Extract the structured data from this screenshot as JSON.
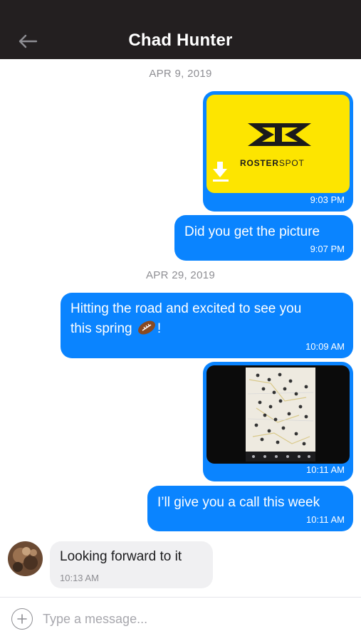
{
  "header": {
    "title": "Chad Hunter",
    "back_icon": "arrow-left-icon",
    "background": "#231f20"
  },
  "colors": {
    "outgoing_bubble": "#0a84ff",
    "incoming_bubble": "#f0f0f2",
    "brand_yellow": "#fde500"
  },
  "dates": {
    "first": "APR 9, 2019",
    "second": "APR 29, 2019"
  },
  "messages": [
    {
      "direction": "outgoing",
      "type": "image",
      "image": {
        "brand_text_bold": "ROSTER",
        "brand_text_light": "SPOT",
        "icon": "download-arrow-icon"
      },
      "time": "9:03 PM"
    },
    {
      "direction": "outgoing",
      "type": "text",
      "text": "Did you get the picture",
      "time": "9:07 PM"
    },
    {
      "direction": "outgoing",
      "type": "text",
      "text_line1": "Hitting the road and excited to see you",
      "text_line2": "this spring",
      "text_line2_suffix": "!",
      "emoji": "football-emoji",
      "time": "10:09 AM"
    },
    {
      "direction": "outgoing",
      "type": "image",
      "image": {
        "content": "map-screenshot"
      },
      "time": "10:11 AM"
    },
    {
      "direction": "outgoing",
      "type": "text",
      "text": "I’ll give you a call this week",
      "time": "10:11 AM"
    },
    {
      "direction": "incoming",
      "type": "text",
      "text": "Looking forward to it",
      "time": "10:13 AM"
    }
  ],
  "composer": {
    "placeholder": "Type a message...",
    "value": "",
    "add_icon": "plus-circle-icon"
  }
}
